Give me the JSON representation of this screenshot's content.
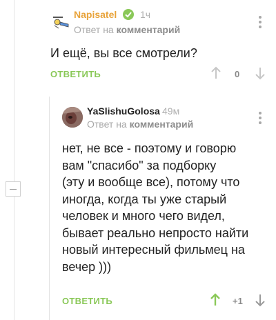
{
  "comments": [
    {
      "username": "Napisatel",
      "verified_icon": "check-circle-icon",
      "time": "1ч",
      "reply_prefix": "Ответ на",
      "reply_target": "комментарий",
      "text": "И ещё, вы все смотрели?",
      "reply_label": "ОТВЕТИТЬ",
      "rating": "0",
      "vote_up_active": false
    },
    {
      "username": "YaSlishuGolosa",
      "time": "49м",
      "reply_prefix": "Ответ на",
      "reply_target": "комментарий",
      "text_lines": [
        "нет, не все - поэтому и говорю",
        "вам \"спасибо\" за подборку",
        "(эту и вообще все), потому что",
        "иногда, когда ты уже старый",
        "человек и много чего видел,",
        "бывает реально непросто найти",
        "новый интересный фильмец на",
        "вечер  )))"
      ],
      "reply_label": "ОТВЕТИТЬ",
      "rating": "+1",
      "vote_up_active": true
    }
  ],
  "colors": {
    "username_first": "#e8a33a",
    "username_second": "#222222",
    "verified_badge": "#8ac858",
    "accent_green": "#8ac858",
    "muted": "#a8a8a8"
  }
}
